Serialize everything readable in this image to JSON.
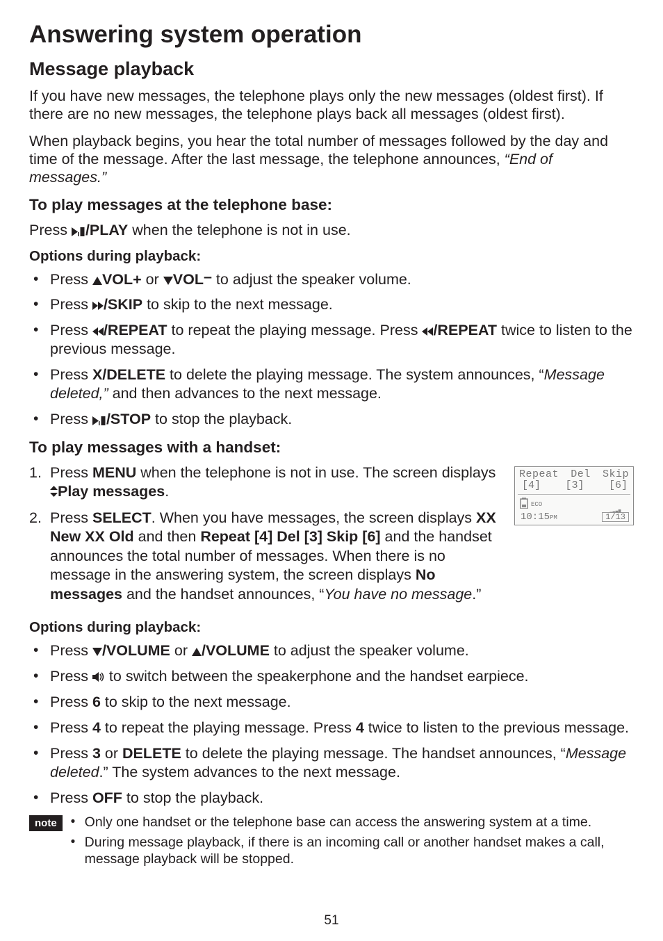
{
  "page": {
    "title": "Answering system operation",
    "subtitle": "Message playback",
    "intro1": "If you have new messages, the telephone plays only the new messages (oldest first). If there are no new messages, the telephone plays back all messages (oldest first).",
    "intro2_pre": "When playback begins, you hear the total number of messages followed by the day and time of the message. After the last message, the telephone announces, ",
    "intro2_em": "“End of messages.”",
    "base_heading": "To play messages at the telephone base:",
    "base_press_pre": "Press ",
    "base_press_btn": "/PLAY",
    "base_press_post": " when the telephone is not in use.",
    "options_heading": "Options during playback:",
    "base_opts": {
      "vol_pre": "Press ",
      "vol_plus": "VOL+",
      "vol_or": " or ",
      "vol_minus": "VOL",
      "vol_minus_suffix": "–",
      "vol_post": " to adjust the speaker volume.",
      "skip_pre": "Press ",
      "skip_btn": "/SKIP",
      "skip_post": " to skip to the next message.",
      "repeat_pre": "Press ",
      "repeat_btn": "/REPEAT",
      "repeat_mid": " to repeat the playing message. Press ",
      "repeat_btn2": "/REPEAT",
      "repeat_post": " twice to listen to the previous message.",
      "delete_pre": "Press ",
      "delete_btn": "X/DELETE",
      "delete_mid": " to delete the playing message. The system announces, “",
      "delete_em": "Message deleted,”",
      "delete_post": " and then advances to the next message.",
      "stop_pre": "Press ",
      "stop_btn": "/STOP",
      "stop_post": " to stop the playback."
    },
    "handset_heading": "To play messages with a handset:",
    "handset_steps": {
      "s1_pre": "Press ",
      "s1_btn": "MENU",
      "s1_mid": " when the telephone is not in use. The screen displays ",
      "s1_menu": "Play messages",
      "s1_post": ".",
      "s2_pre": "Press ",
      "s2_btn": "SELECT",
      "s2_mid1": ". When you have messages, the screen displays ",
      "s2_b1": "XX New XX Old",
      "s2_mid2": " and then ",
      "s2_b2": "Repeat [4] Del [3] Skip [6]",
      "s2_mid3": " and the handset announces the total number of messages. When there is no message in the answering system, the screen displays ",
      "s2_b3": "No messages",
      "s2_mid4": " and the handset announces, “",
      "s2_em": "You have no message",
      "s2_post": ".”"
    },
    "handset_opts": {
      "vol_pre": "Press ",
      "vol_dn": "/VOLUME",
      "vol_or": " or ",
      "vol_up": "/VOLUME",
      "vol_post": " to adjust the speaker volume.",
      "spk_pre": "Press ",
      "spk_post": " to switch between the speakerphone and the handset earpiece.",
      "skip_pre": "Press ",
      "skip_key": "6",
      "skip_post": " to skip to the next message.",
      "repeat_pre": "Press ",
      "repeat_key": "4",
      "repeat_mid": " to repeat the playing message. Press ",
      "repeat_key2": "4",
      "repeat_post": " twice to listen to the previous message.",
      "delete_pre": "Press ",
      "delete_key": "3",
      "delete_or": " or ",
      "delete_btn": "DELETE",
      "delete_mid": " to delete the playing message. The handset announces, “",
      "delete_em": "Message deleted",
      "delete_post": ".” The system advances to the next message.",
      "stop_pre": "Press ",
      "stop_btn": "OFF",
      "stop_post": " to stop the playback."
    },
    "note_label": "note",
    "notes": {
      "n1": "Only one handset or the telephone base can access the answering system at a time.",
      "n2": "During message playback, if there is an incoming call or another handset makes a call, message playback will be stopped."
    },
    "page_number": "51"
  },
  "lcd": {
    "row1a": "Repeat",
    "row1b": "Del",
    "row1c": "Skip",
    "row2a": "[4]",
    "row2b": "[3]",
    "row2c": "[6]",
    "eco": "ECO",
    "time": "10:15",
    "ampm": "PM",
    "count": "1/13"
  }
}
